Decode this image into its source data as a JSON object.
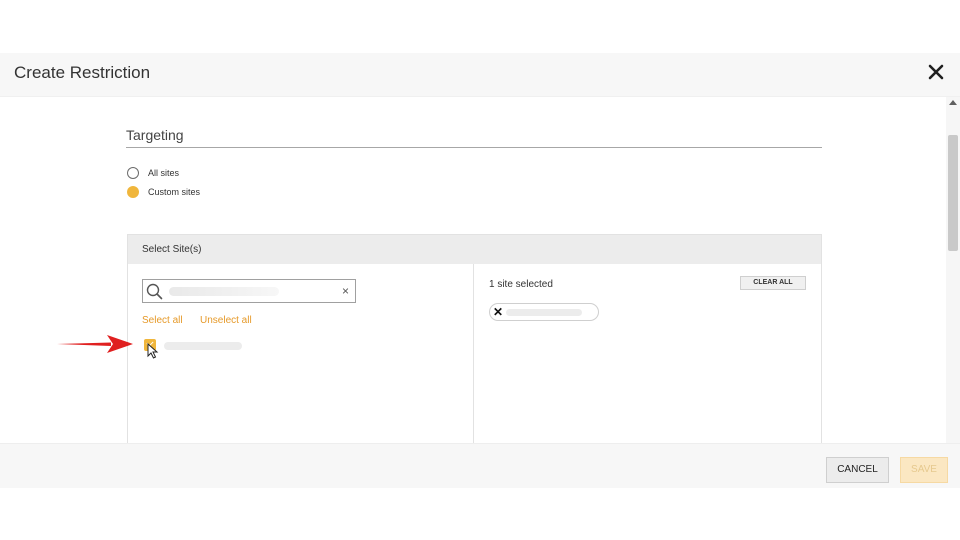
{
  "dialog": {
    "title": "Create Restriction"
  },
  "targeting": {
    "section_title": "Targeting",
    "options": [
      {
        "label": "All sites",
        "selected": false
      },
      {
        "label": "Custom sites",
        "selected": true
      }
    ]
  },
  "select_sites": {
    "header": "Select Site(s)",
    "search": {
      "value": "",
      "placeholder": ""
    },
    "select_all_label": "Select all",
    "unselect_all_label": "Unselect all",
    "selected_count_text": "1 site selected",
    "clear_all_label": "CLEAR ALL"
  },
  "footer": {
    "cancel_label": "CANCEL",
    "save_label": "SAVE"
  },
  "colors": {
    "accent": "#f0b63c",
    "link": "#e69a2a",
    "arrow": "#e02020",
    "save_disabled_bg": "#fbe7c2"
  },
  "icons": [
    "close-icon",
    "search-icon",
    "clear-icon",
    "check-icon",
    "remove-icon",
    "cursor-icon",
    "red-arrow-icon"
  ]
}
